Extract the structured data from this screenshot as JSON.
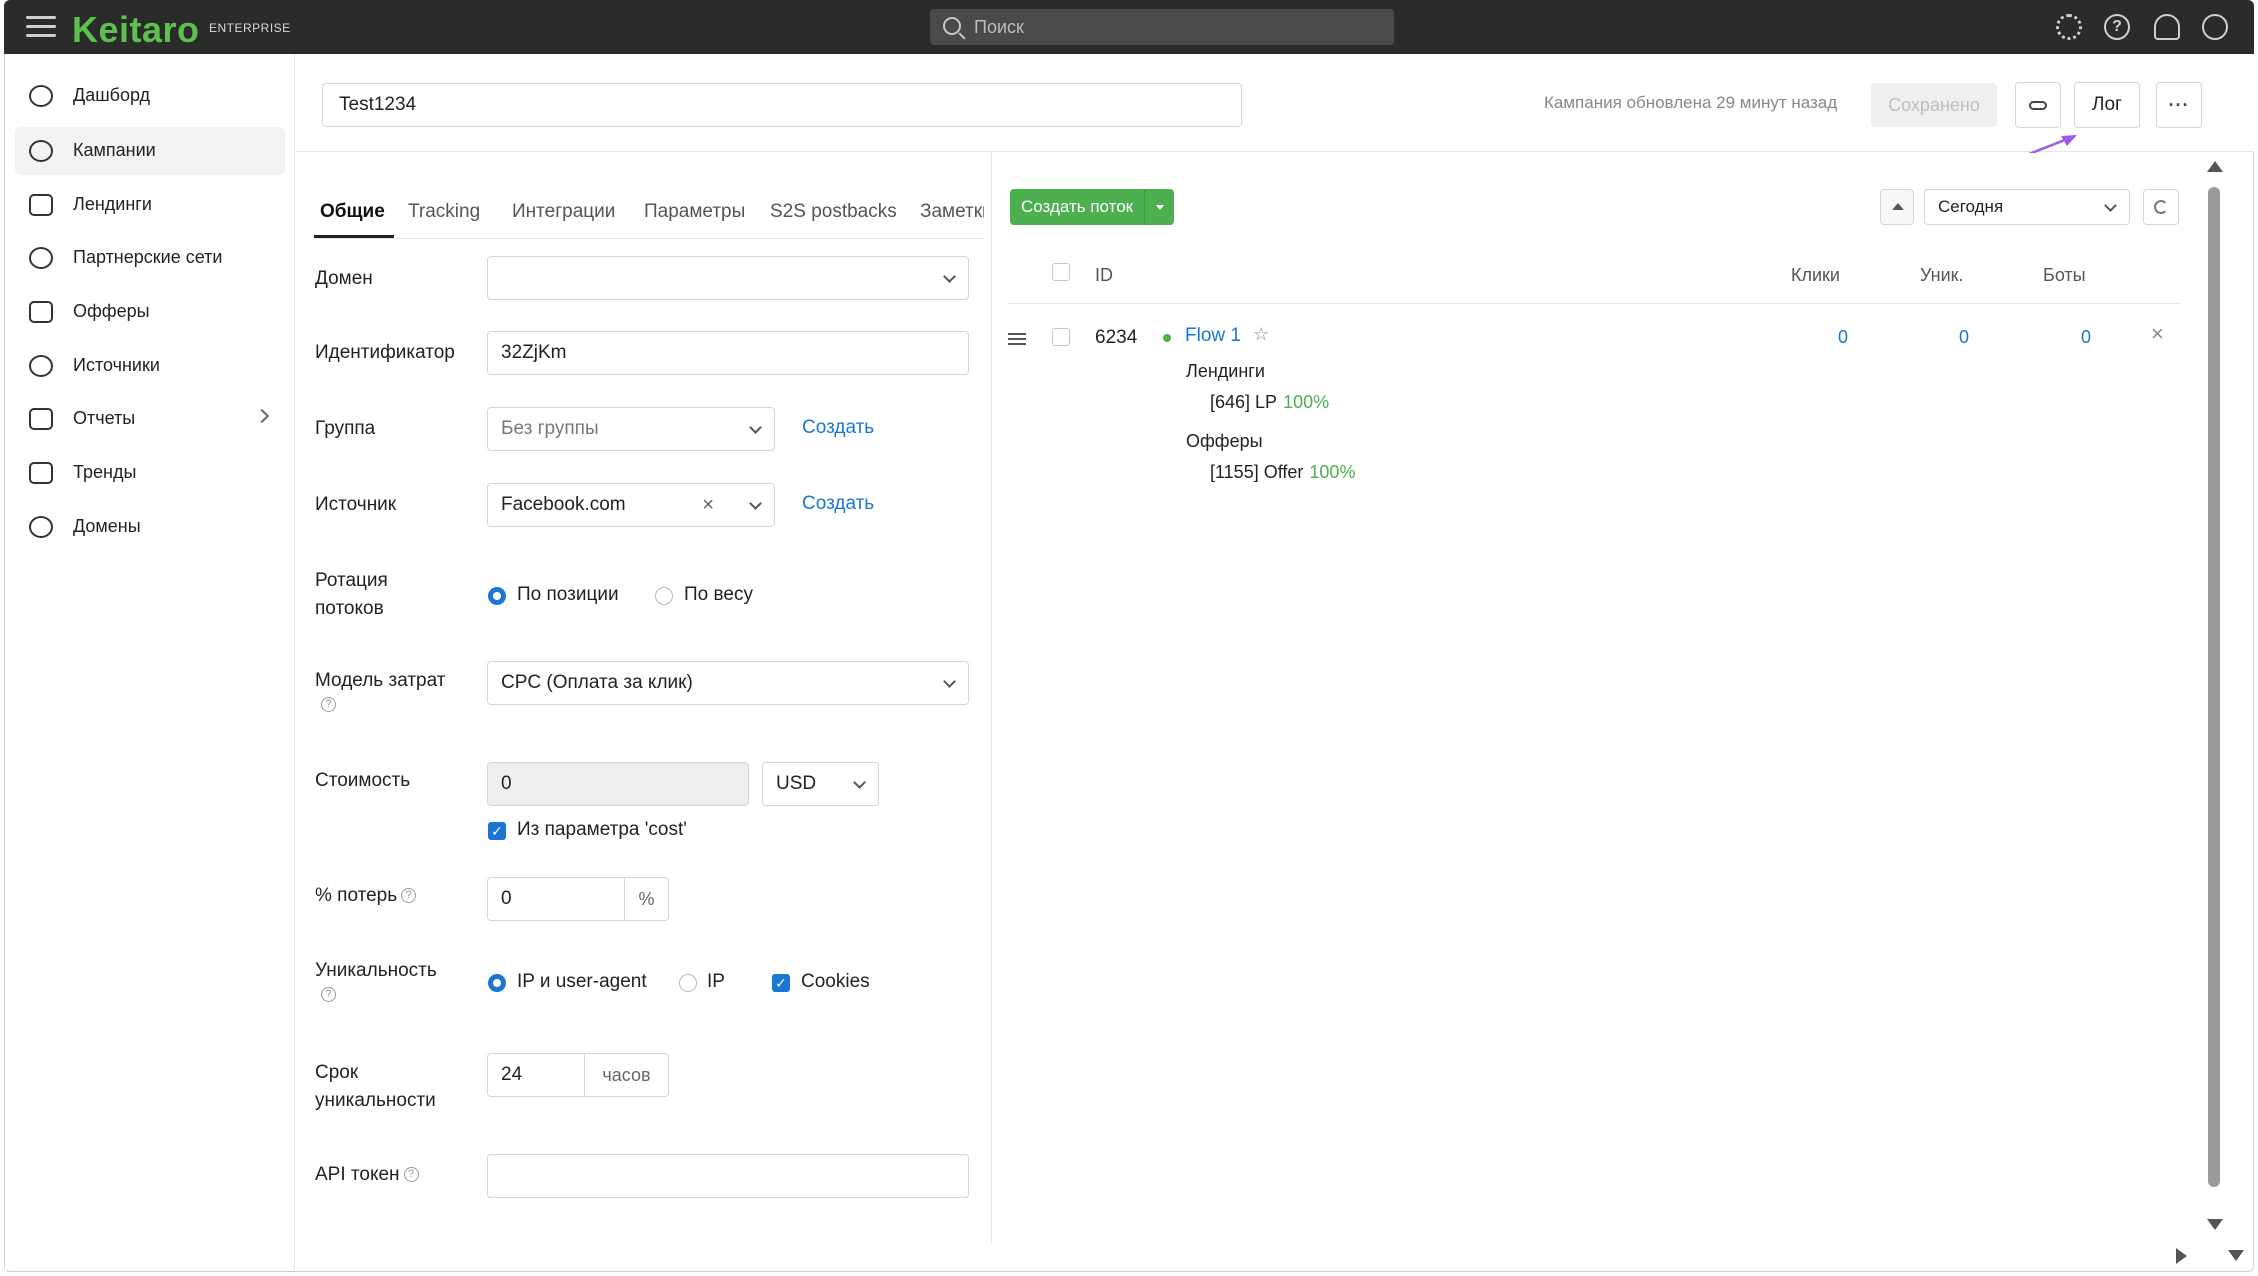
{
  "app": {
    "logo": "Keitaro",
    "edition": "ENTERPRISE",
    "search_placeholder": "Поиск"
  },
  "topbar_icons": [
    "gear-icon",
    "help-icon",
    "bell-icon",
    "user-icon"
  ],
  "sidebar": {
    "items": [
      {
        "label": "Дашборд",
        "icon": "dashboard-icon"
      },
      {
        "label": "Кампании",
        "icon": "target-icon",
        "active": true
      },
      {
        "label": "Лендинги",
        "icon": "document-icon"
      },
      {
        "label": "Партнерские сети",
        "icon": "people-icon"
      },
      {
        "label": "Офферы",
        "icon": "tag-icon"
      },
      {
        "label": "Источники",
        "icon": "source-icon"
      },
      {
        "label": "Отчеты",
        "icon": "report-icon",
        "has_submenu": true
      },
      {
        "label": "Тренды",
        "icon": "trend-icon"
      },
      {
        "label": "Домены",
        "icon": "globe-icon"
      }
    ]
  },
  "header": {
    "campaign_name": "Test1234",
    "updated_text": "Кампания обновлена 29 минут назад",
    "saved_label": "Сохранено",
    "log_label": "Лог",
    "more_label": "···"
  },
  "tabs": [
    "Общие",
    "Tracking",
    "Интеграции",
    "Параметры",
    "S2S postbacks",
    "Заметки"
  ],
  "form": {
    "domain_label": "Домен",
    "domain_value": "",
    "identifier_label": "Идентификатор",
    "identifier_value": "32ZjKm",
    "group_label": "Группа",
    "group_value": "Без группы",
    "create_link": "Создать",
    "source_label": "Источник",
    "source_value": "Facebook.com",
    "rotation_label_1": "Ротация",
    "rotation_label_2": "потоков",
    "rotation_opt_position": "По позиции",
    "rotation_opt_weight": "По весу",
    "cost_model_label": "Модель затрат",
    "cost_model_value": "CPC (Оплата за клик)",
    "cost_label": "Стоимость",
    "cost_value": "0",
    "currency_value": "USD",
    "cost_param_label": "Из параметра 'cost'",
    "loss_label": "% потерь",
    "loss_value": "0",
    "loss_unit": "%",
    "uniqueness_label": "Уникальность",
    "uniq_opt_ip_ua": "IP и user-agent",
    "uniq_opt_ip": "IP",
    "uniq_opt_cookies": "Cookies",
    "uniq_term_label_1": "Срок",
    "uniq_term_label_2": "уникальности",
    "uniq_term_value": "24",
    "uniq_term_unit": "часов",
    "api_token_label": "API токен",
    "api_token_value": "",
    "help_glyph": "?"
  },
  "flows": {
    "create_label": "Создать поток",
    "period_value": "Сегодня",
    "columns": {
      "id": "ID",
      "clicks": "Клики",
      "unique": "Уник.",
      "bots": "Боты"
    },
    "rows": [
      {
        "id": "6234",
        "name": "Flow 1",
        "clicks": "0",
        "unique": "0",
        "bots": "0",
        "landings_title": "Лендинги",
        "landing_item": "[646] LP",
        "landing_pct": "100%",
        "offers_title": "Офферы",
        "offer_item": "[1155] Offer",
        "offer_pct": "100%"
      }
    ]
  },
  "colors": {
    "topbar_bg": "#2b2b2b",
    "brand_green": "#5cc24d",
    "primary_blue": "#1976d2",
    "success_green": "#4caf50",
    "annotation_purple": "#9b5de5"
  }
}
